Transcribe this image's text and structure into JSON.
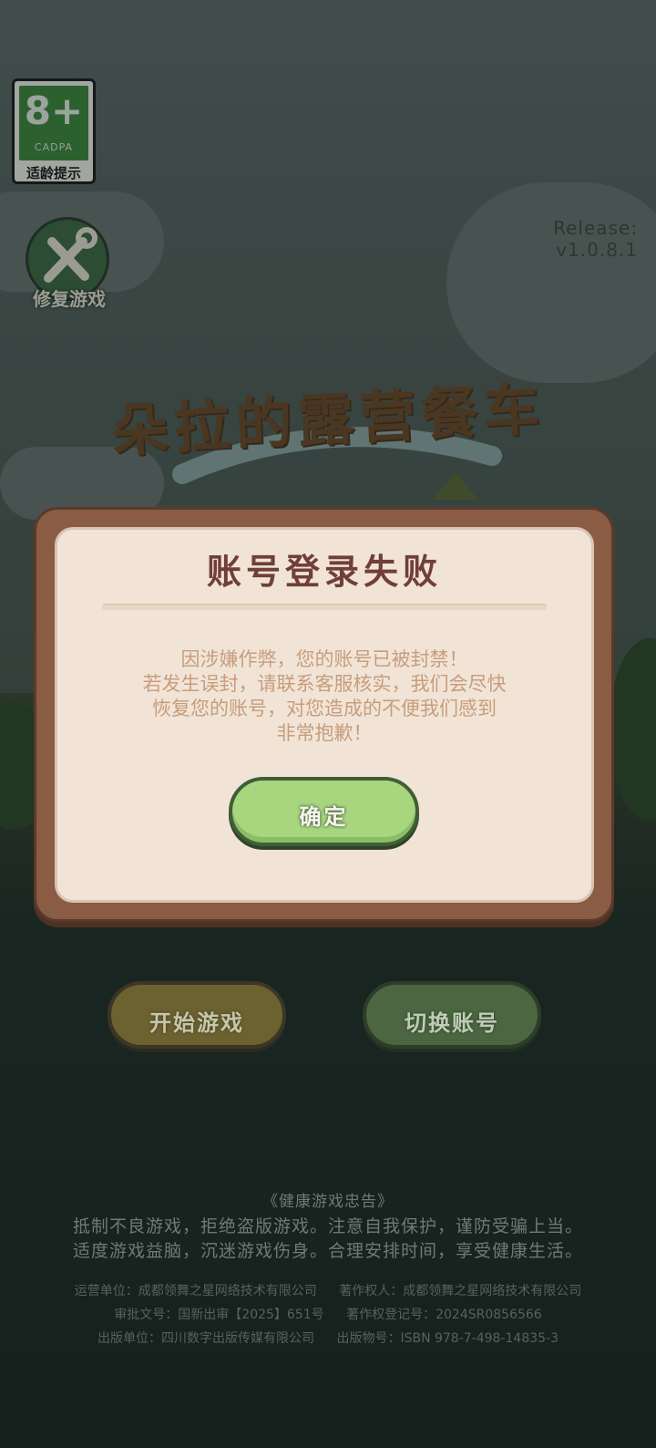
{
  "age_rating": {
    "number": "8+",
    "org": "CADPA",
    "hint": "适龄提示"
  },
  "repair": {
    "label": "修复游戏"
  },
  "release": "Release: v1.0.8.1",
  "logo": {
    "title": "朵拉的露营餐车"
  },
  "dialog": {
    "title": "账号登录失败",
    "message_lines": [
      "因涉嫌作弊，您的账号已被封禁！",
      "若发生误封，请联系客服核实，我们会尽快",
      "恢复您的账号，对您造成的不便我们感到",
      "非常抱歉！"
    ],
    "confirm_label": "确定"
  },
  "buttons": {
    "start": "开始游戏",
    "switch": "切换账号"
  },
  "health_notice": {
    "title": "《健康游戏忠告》",
    "line1": "抵制不良游戏，拒绝盗版游戏。注意自我保护，谨防受骗上当。",
    "line2": "适度游戏益脑，沉迷游戏伤身。合理安排时间，享受健康生活。"
  },
  "credits": {
    "operator": "运营单位：成都领舞之星网络技术有限公司",
    "copyright": "著作权人：成都领舞之星网络技术有限公司",
    "approval": "审批文号：国新出审【2025】651号",
    "registration": "著作权登记号：2024SR0856566",
    "publisher": "出版单位：四川数字出版传媒有限公司",
    "isbn": "出版物号：ISBN 978-7-498-14835-3"
  },
  "colors": {
    "dialog_frame": "#8a5c44",
    "dialog_bg": "#f1e4d6",
    "confirm_green": "#a7d67f",
    "title_brown": "#6f3f38"
  }
}
